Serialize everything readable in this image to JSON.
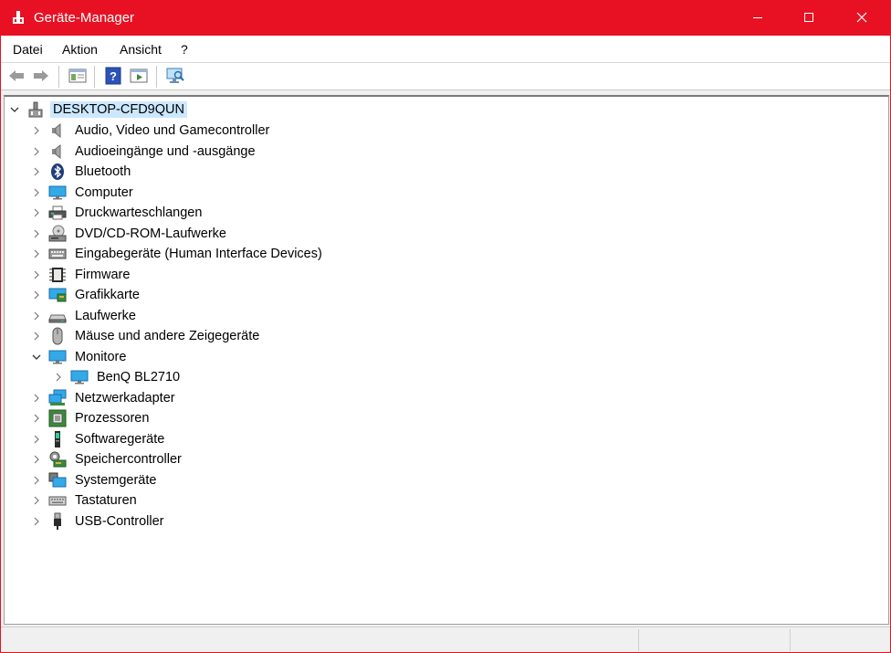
{
  "window": {
    "title": "Geräte-Manager",
    "accent_color": "#e81123",
    "controls": {
      "minimize": "minimize-icon",
      "maximize": "maximize-icon",
      "close": "close-icon"
    }
  },
  "menu": {
    "items": [
      {
        "label": "Datei"
      },
      {
        "label": "Aktion"
      },
      {
        "label": "Ansicht"
      },
      {
        "label": "?"
      }
    ]
  },
  "toolbar": {
    "buttons": [
      "back-arrow-icon",
      "forward-arrow-icon",
      "properties-icon",
      "help-icon",
      "run-icon",
      "scan-hardware-icon"
    ]
  },
  "tree": {
    "root": {
      "label": "DESKTOP-CFD9QUN",
      "expanded": true
    },
    "categories": [
      {
        "label": "Audio, Video und Gamecontroller",
        "icon": "speaker-icon",
        "expanded": false
      },
      {
        "label": "Audioeingänge und -ausgänge",
        "icon": "speaker-icon",
        "expanded": false
      },
      {
        "label": "Bluetooth",
        "icon": "bluetooth-icon",
        "expanded": false
      },
      {
        "label": "Computer",
        "icon": "monitor-icon",
        "expanded": false
      },
      {
        "label": "Druckwarteschlangen",
        "icon": "printer-icon",
        "expanded": false
      },
      {
        "label": "DVD/CD-ROM-Laufwerke",
        "icon": "disc-drive-icon",
        "expanded": false
      },
      {
        "label": "Eingabegeräte (Human Interface Devices)",
        "icon": "hid-icon",
        "expanded": false
      },
      {
        "label": "Firmware",
        "icon": "chip-icon",
        "expanded": false
      },
      {
        "label": "Grafikkarte",
        "icon": "display-adapter-icon",
        "expanded": false
      },
      {
        "label": "Laufwerke",
        "icon": "disk-drive-icon",
        "expanded": false
      },
      {
        "label": "Mäuse und andere Zeigegeräte",
        "icon": "mouse-icon",
        "expanded": false
      },
      {
        "label": "Monitore",
        "icon": "monitor-icon",
        "expanded": true,
        "children": [
          {
            "label": "BenQ BL2710",
            "icon": "monitor-icon"
          }
        ]
      },
      {
        "label": "Netzwerkadapter",
        "icon": "network-adapter-icon",
        "expanded": false
      },
      {
        "label": "Prozessoren",
        "icon": "processor-icon",
        "expanded": false
      },
      {
        "label": "Softwaregeräte",
        "icon": "software-device-icon",
        "expanded": false
      },
      {
        "label": "Speichercontroller",
        "icon": "storage-controller-icon",
        "expanded": false
      },
      {
        "label": "Systemgeräte",
        "icon": "system-devices-icon",
        "expanded": false
      },
      {
        "label": "Tastaturen",
        "icon": "keyboard-icon",
        "expanded": false
      },
      {
        "label": "USB-Controller",
        "icon": "usb-icon",
        "expanded": false
      }
    ]
  }
}
